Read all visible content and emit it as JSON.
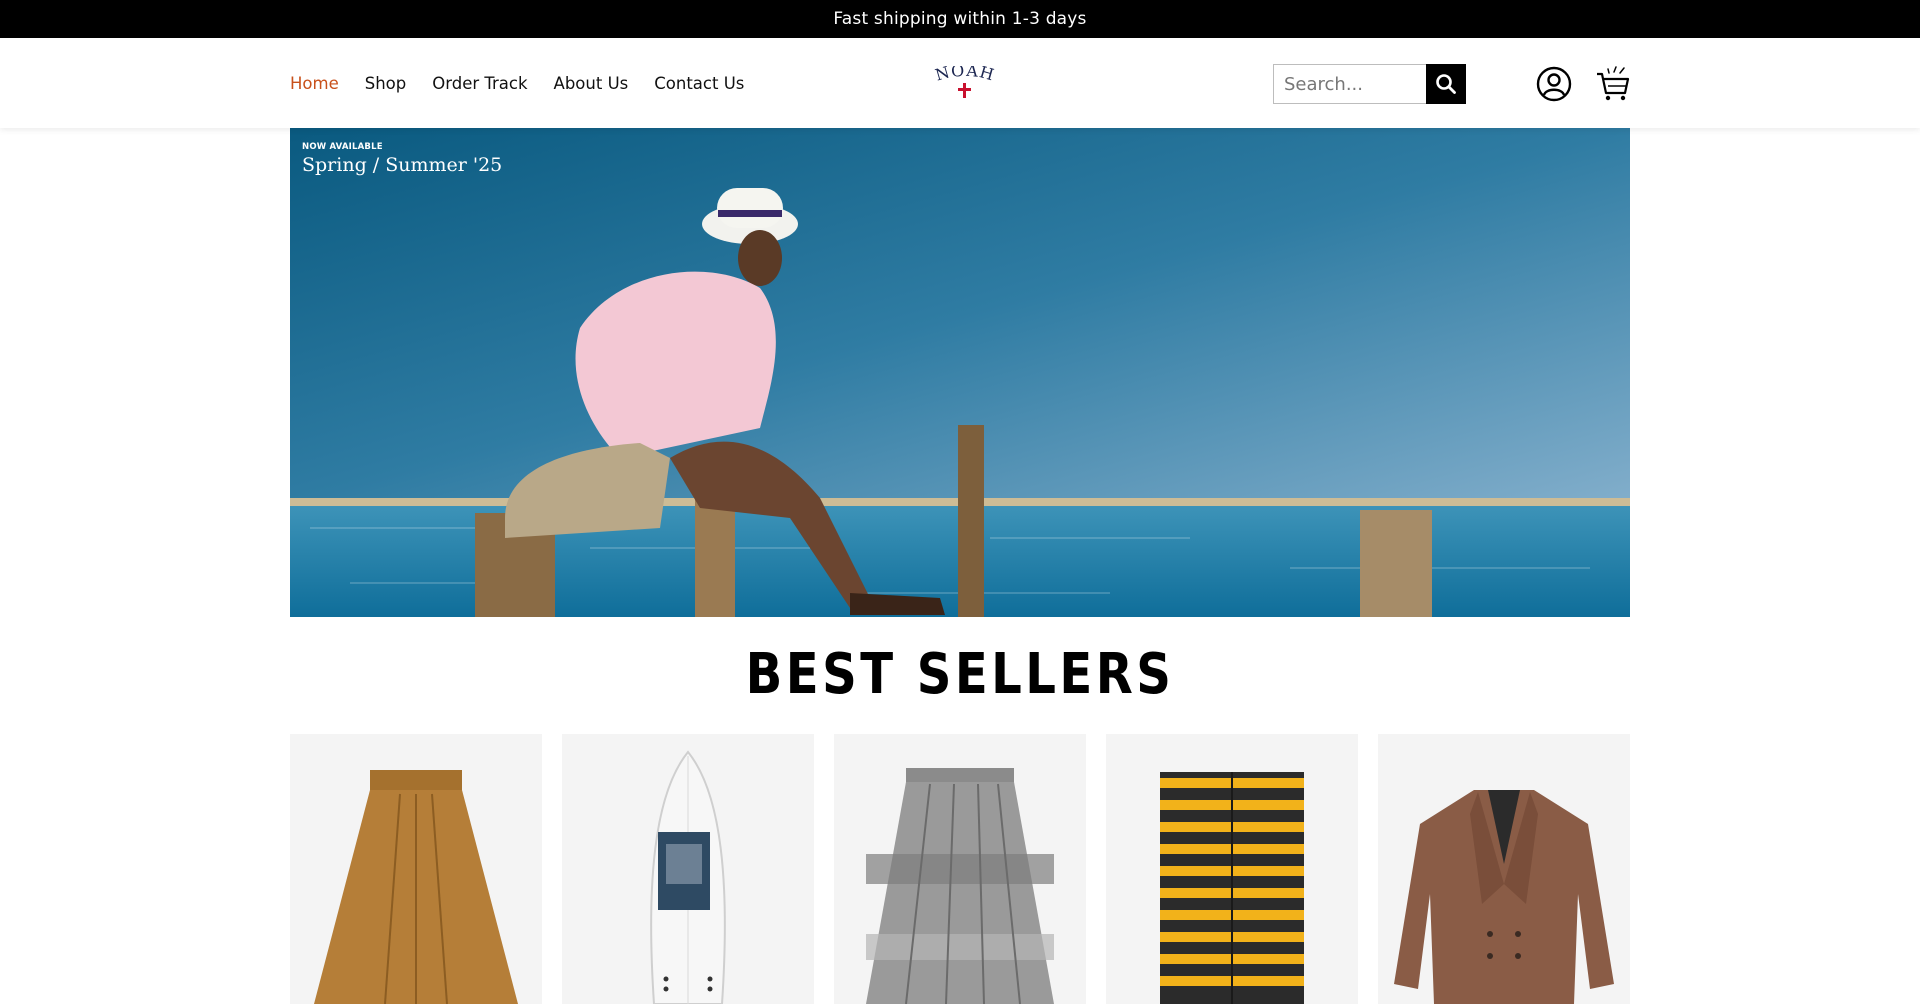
{
  "announcement": {
    "text": "Fast shipping within 1-3 days"
  },
  "nav": {
    "items": [
      {
        "label": "Home",
        "active": true
      },
      {
        "label": "Shop",
        "active": false
      },
      {
        "label": "Order Track",
        "active": false
      },
      {
        "label": "About Us",
        "active": false
      },
      {
        "label": "Contact Us",
        "active": false
      }
    ]
  },
  "logo": {
    "text": "NOAH",
    "icon": "cross-icon"
  },
  "search": {
    "placeholder": "Search...",
    "value": "",
    "button_icon": "search-icon"
  },
  "header_icons": {
    "account": "user-icon",
    "cart": "cart-icon"
  },
  "hero": {
    "badge": "NOW AVAILABLE",
    "title": "Spring / Summer '25"
  },
  "best_sellers": {
    "title": "BEST SELLERS",
    "products": [
      {
        "item": "brown pleated skirt"
      },
      {
        "item": "white surfboard"
      },
      {
        "item": "grey plaid pleated skirt"
      },
      {
        "item": "yellow and black striped scarf"
      },
      {
        "item": "brown double-breasted blazer"
      }
    ]
  },
  "colors": {
    "accent": "#c8501a",
    "announcement_bg": "#000000"
  }
}
